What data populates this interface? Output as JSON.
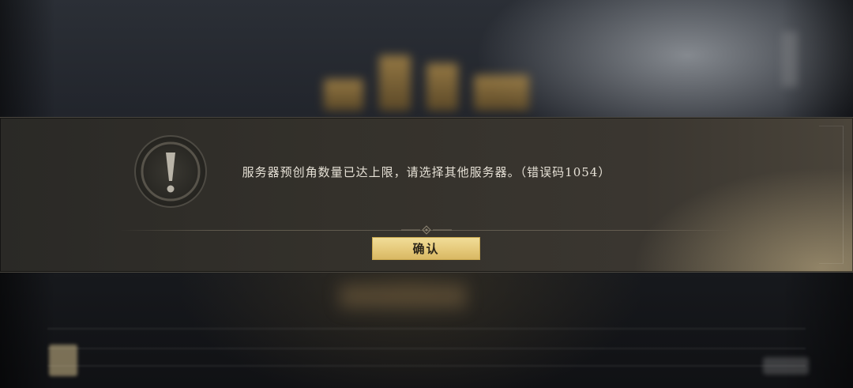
{
  "dialog": {
    "message": "服务器预创角数量已达上限，请选择其他服务器。（错误码1054）",
    "confirm_label": "确认",
    "icon": "exclamation-icon"
  },
  "colors": {
    "banner": "#34312b",
    "button": "#e5c97a",
    "text": "#e6e1d6"
  }
}
